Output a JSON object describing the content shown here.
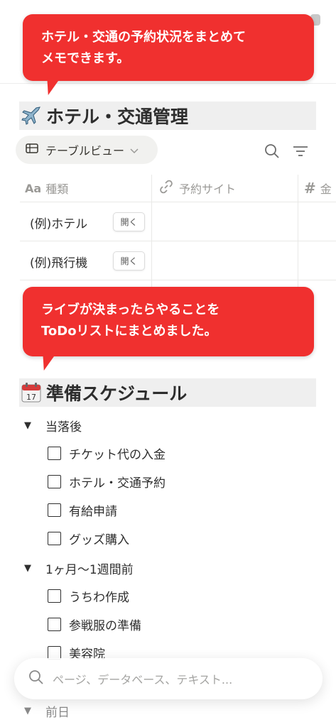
{
  "bubbles": [
    {
      "line1": "ホテル・交通の予約状況をまとめて",
      "line2": "メモできます。"
    },
    {
      "line1": "ライブが決まったらやることを",
      "line2": "ToDoリストにまとめました。"
    }
  ],
  "section1": {
    "emoji": "airplane-emoji",
    "title": "ホテル・交通管理"
  },
  "view": {
    "tab_label": "テーブルビュー"
  },
  "table": {
    "columns": [
      {
        "icon": "Aa",
        "label": "種類"
      },
      {
        "icon": "link-icon",
        "label": "予約サイト"
      },
      {
        "icon": "#",
        "label": "金"
      }
    ],
    "rows": [
      {
        "name": "(例)ホテル",
        "open_label": "開く"
      },
      {
        "name": "(例)飛行機",
        "open_label": "開く"
      }
    ]
  },
  "section2": {
    "emoji": "calendar-emoji",
    "date": "17",
    "title": "準備スケジュール"
  },
  "groups": [
    {
      "label": "当落後",
      "items": [
        "チケット代の入金",
        "ホテル・交通予約",
        "有給申請",
        "グッズ購入"
      ]
    },
    {
      "label": "1ヶ月〜1週間前",
      "items": [
        "うちわ作成",
        "参戦服の準備",
        "美容院"
      ]
    },
    {
      "label": "前日"
    }
  ],
  "search": {
    "placeholder": "ページ、データベース、テキスト..."
  },
  "colors": {
    "bubble": "#f0302f",
    "heading_bg": "#efefef",
    "text": "#2f2f2f",
    "muted": "#9b9a97"
  }
}
